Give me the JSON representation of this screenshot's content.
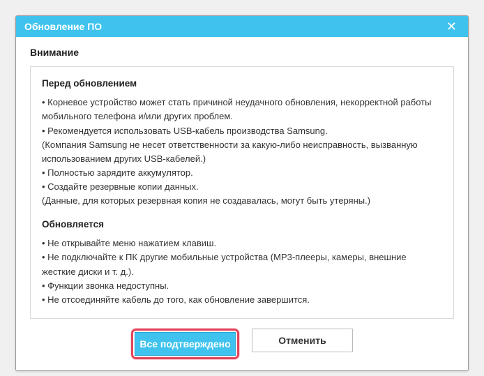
{
  "titlebar": {
    "title": "Обновление ПО"
  },
  "content": {
    "attention": "Внимание",
    "section1": {
      "heading": "Перед обновлением",
      "lines": [
        "• Корневое устройство может стать причиной неудачного обновления, некорректной работы мобильного телефона и/или других проблем.",
        "• Рекомендуется использовать USB-кабель производства Samsung.",
        "(Компания Samsung не несет ответственности за какую-либо неисправность, вызванную использованием других USB-кабелей.)",
        "• Полностью зарядите аккумулятор.",
        "• Создайте резервные копии данных.",
        "(Данные, для которых резервная копия не создавалась, могут быть утеряны.)"
      ]
    },
    "section2": {
      "heading": "Обновляется",
      "lines": [
        "• Не открывайте меню нажатием клавиш.",
        "• Не подключайте к ПК другие мобильные устройства (MP3-плееры, камеры, внешние жесткие диски и т. д.).",
        "• Функции звонка недоступны.",
        "• Не отсоединяйте кабель до того, как обновление завершится."
      ]
    }
  },
  "buttons": {
    "confirm": "Все подтверждено",
    "cancel": "Отменить"
  }
}
